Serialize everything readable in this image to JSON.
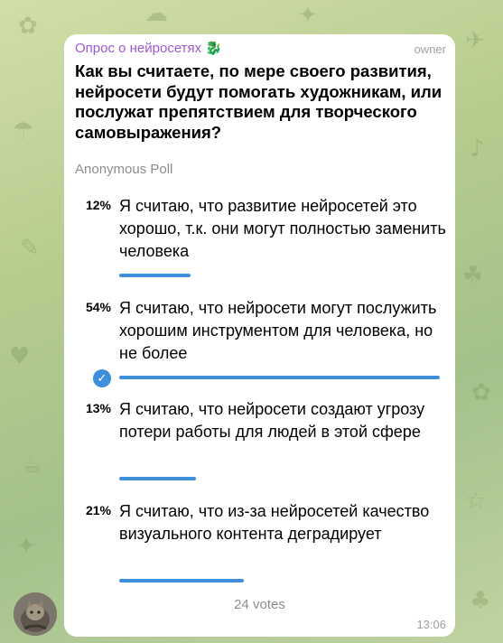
{
  "message": {
    "sender_name": "Опрос о нейросетях",
    "sender_icon": "dragon-emoji-icon",
    "sender_role": "owner",
    "time": "13:06"
  },
  "poll": {
    "question": "Как вы считаете, по мере своего развития, нейросети будут помогать художникам, или послужат препятствием для творческого самовыражения?",
    "type_label": "Anonymous Poll",
    "accent_color": "#3e8fd9",
    "options": [
      {
        "percent_label": "12%",
        "percent": 12,
        "text": "Я считаю, что развитие нейросетей это хорошо, т.к. они могут полностью заменить человека",
        "chosen": false
      },
      {
        "percent_label": "54%",
        "percent": 54,
        "text": "Я считаю, что нейросети могут послужить хорошим инструментом для человека, но не более",
        "chosen": true
      },
      {
        "percent_label": "13%",
        "percent": 13,
        "text": "Я считаю, что нейросети создают угрозу потери работы для людей в этой сфере",
        "chosen": false
      },
      {
        "percent_label": "21%",
        "percent": 21,
        "text": "Я считаю, что из-за нейросетей качество визуального контента деградирует",
        "chosen": false
      }
    ],
    "votes_label": "24 votes"
  },
  "colors": {
    "sender_name": "#9b59d0",
    "bubble_bg": "#ffffff",
    "wallpaper": "#b6cc8e"
  }
}
